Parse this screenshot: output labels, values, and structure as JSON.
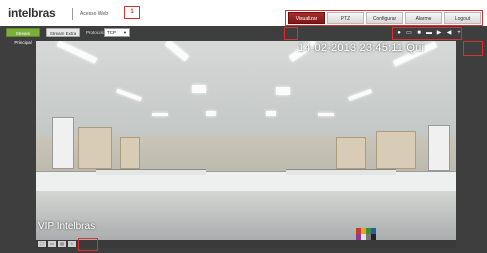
{
  "header": {
    "logo": "intelbras",
    "subtitle": "Acesso Web",
    "marker_1": "1"
  },
  "nav": {
    "tabs": [
      {
        "label": "Visualizar",
        "active": true
      },
      {
        "label": "PTZ",
        "active": false
      },
      {
        "label": "Configurar",
        "active": false
      },
      {
        "label": "Alarme",
        "active": false
      },
      {
        "label": "Logout",
        "active": false
      }
    ]
  },
  "toolbar": {
    "main_stream_label": "Stream Principal",
    "extra_stream_label": "Stream Extra",
    "protocol_label": "Protocolo",
    "protocol_value": "TCP",
    "icons": [
      "person-icon",
      "display-icon",
      "record-icon",
      "snapshot-icon",
      "play-icon",
      "audio-icon",
      "zoom-icon"
    ]
  },
  "video": {
    "timestamp": "14-02-2013 23:45:11 Qui",
    "channel_name": "VIP Intelbras"
  },
  "bottom": {
    "icons": [
      "fullscreen-icon",
      "window-icon",
      "aspect-icon",
      "settings-icon"
    ]
  },
  "colors": {
    "accent_red": "#8b1e1e",
    "stream_green": "#7cae3c",
    "frame_bg": "#3e3e3e",
    "marker_red": "#d93030"
  }
}
